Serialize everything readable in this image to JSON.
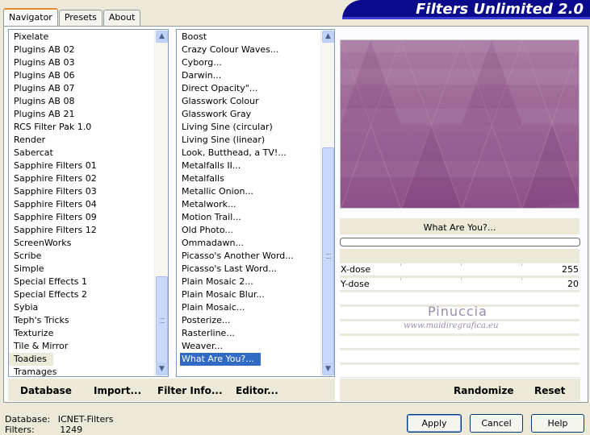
{
  "tabs": [
    {
      "label": "Navigator"
    },
    {
      "label": "Presets"
    },
    {
      "label": "About"
    }
  ],
  "banner": {
    "title": "Filters Unlimited 2.0"
  },
  "categories": [
    "Pixelate",
    "Plugins AB 02",
    "Plugins AB 03",
    "Plugins AB 06",
    "Plugins AB 07",
    "Plugins AB 08",
    "Plugins AB 21",
    "RCS Filter Pak 1.0",
    "Render",
    "Sabercat",
    "Sapphire Filters 01",
    "Sapphire Filters 02",
    "Sapphire Filters 03",
    "Sapphire Filters 04",
    "Sapphire Filters 09",
    "Sapphire Filters 12",
    "ScreenWorks",
    "Scribe",
    "Simple",
    "Special Effects 1",
    "Special Effects 2",
    "Sybia",
    "Teph's Tricks",
    "Texturize",
    "Tile & Mirror",
    "Toadies",
    "Tramages"
  ],
  "selected_category": "Toadies",
  "filters": [
    "Boost",
    "Crazy Colour Waves...",
    "Cyborg...",
    "Darwin...",
    "Direct Opacity\"...",
    "Glasswork Colour",
    "Glasswork Gray",
    "Living Sine (circular)",
    "Living Sine (linear)",
    "Look, Butthead, a TV!...",
    "Metalfalls II...",
    "Metalfalls",
    "Metallic Onion...",
    "Metalwork...",
    "Motion Trail...",
    "Old Photo...",
    "Ommadawn...",
    "Picasso's Another Word...",
    "Picasso's Last Word...",
    "Plain Mosaic 2...",
    "Plain Mosaic Blur...",
    "Plain Mosaic...",
    "Posterize...",
    "Rasterline...",
    "Weaver...",
    "What Are You?..."
  ],
  "selected_filter": "What Are You?...",
  "filter_name": "What Are You?...",
  "params": [
    {
      "label": "X-dose",
      "value": "255"
    },
    {
      "label": "Y-dose",
      "value": "20"
    }
  ],
  "watermark": {
    "name": "Pinuccia",
    "site": "www.maidiregrafica.eu"
  },
  "actions": {
    "database": "Database",
    "import": "Import...",
    "filter_info": "Filter Info...",
    "editor": "Editor...",
    "randomize": "Randomize",
    "reset": "Reset"
  },
  "status": {
    "database_label": "Database:",
    "database_value": "ICNET-Filters",
    "filters_label": "Filters:",
    "filters_value": "1249"
  },
  "buttons": {
    "apply": "Apply",
    "cancel": "Cancel",
    "help": "Help"
  },
  "colors": {
    "selection": "#316ac5",
    "banner": "#0a0a8c",
    "preview": "#9a5a94"
  }
}
